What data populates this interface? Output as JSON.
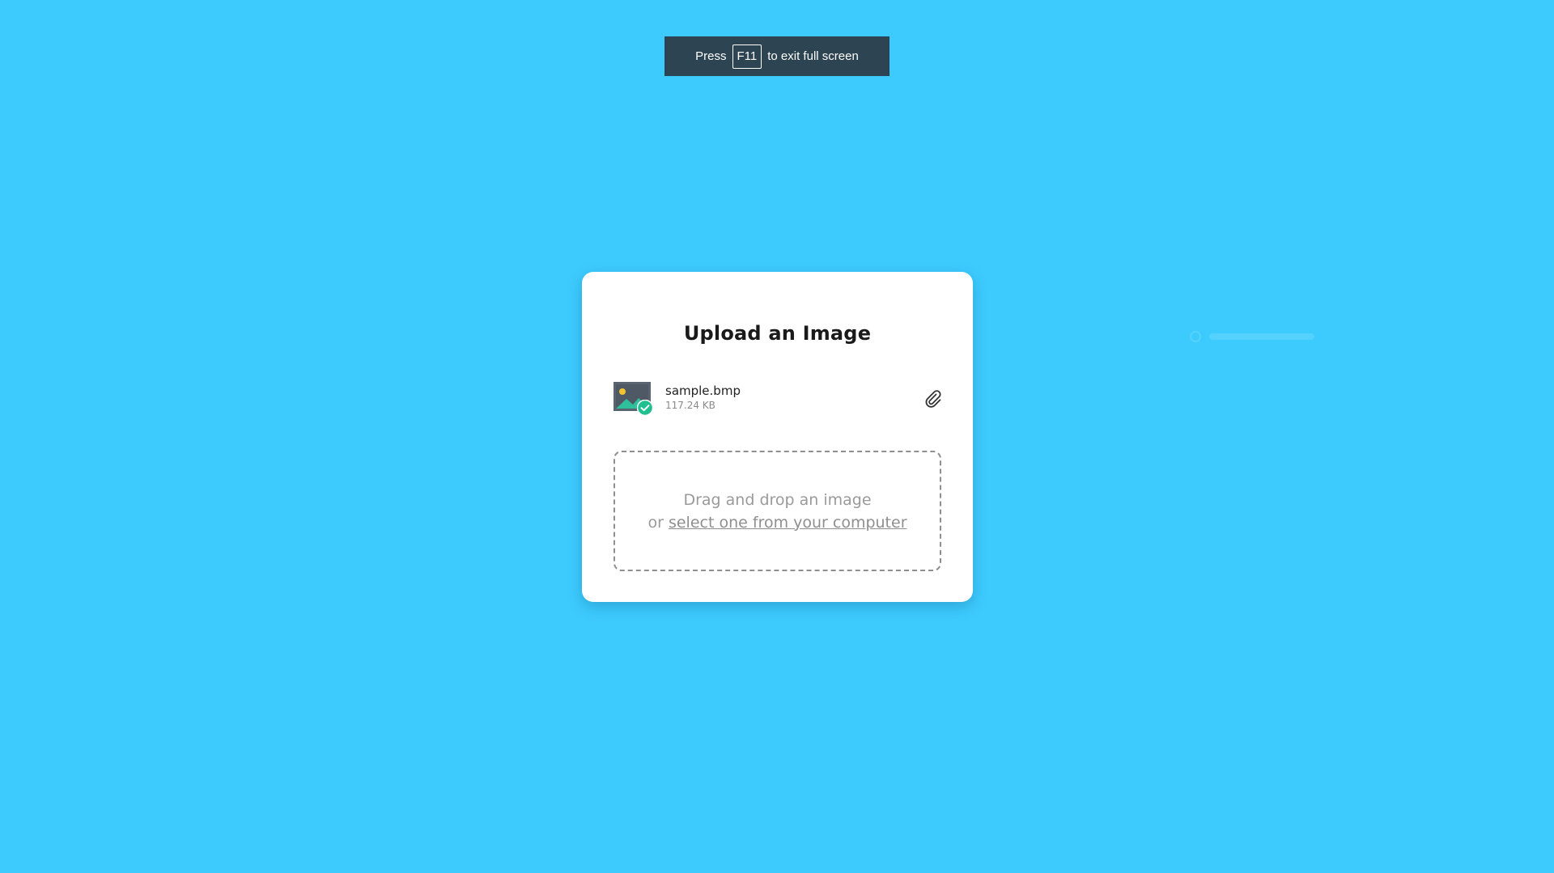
{
  "fullscreen_toast": {
    "before": "Press",
    "key": "F11",
    "after": "to exit full screen"
  },
  "upload_card": {
    "title": "Upload an Image",
    "file": {
      "name": "sample.bmp",
      "size": "117.24 KB",
      "thumb_icon": "image-icon",
      "status_icon": "check-circle-icon",
      "action_icon": "paperclip-icon"
    },
    "dropzone": {
      "line1": "Drag and drop an image",
      "prefix": "or",
      "link_text": "select one from your computer"
    }
  },
  "colors": {
    "background": "#3dcbfe",
    "card": "#ffffff",
    "toast": "#2d4452",
    "success": "#1fbf8f"
  }
}
